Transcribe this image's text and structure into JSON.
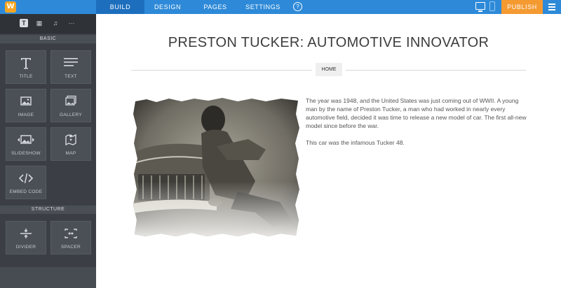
{
  "topbar": {
    "logo": "W",
    "nav": [
      "BUILD",
      "DESIGN",
      "PAGES",
      "SETTINGS"
    ],
    "help": "?",
    "publish": "PUBLISH"
  },
  "sidebar": {
    "tabs": [
      "T",
      "▦",
      "♫",
      "···"
    ],
    "basic_label": "BASIC",
    "structure_label": "STRUCTURE",
    "basic_items": [
      {
        "label": "TITLE",
        "icon": "title-icon"
      },
      {
        "label": "TEXT",
        "icon": "text-icon"
      },
      {
        "label": "IMAGE",
        "icon": "image-icon"
      },
      {
        "label": "GALLERY",
        "icon": "gallery-icon"
      },
      {
        "label": "SLIDESHOW",
        "icon": "slideshow-icon"
      },
      {
        "label": "MAP",
        "icon": "map-icon"
      },
      {
        "label": "EMBED CODE",
        "icon": "embed-code-icon"
      }
    ],
    "structure_items": [
      {
        "label": "DIVIDER",
        "icon": "divider-icon"
      },
      {
        "label": "SPACER",
        "icon": "spacer-icon"
      }
    ]
  },
  "content": {
    "title": "PRESTON TUCKER: AUTOMOTIVE INNOVATOR",
    "home_button": "HOME",
    "paragraph1": "The year was 1948, and the United States was just coming out of WWII. A young man by the name of Preston Tucker, a man who had worked in nearly every automotive field, decided it was time to release a new model of car. The first all-new model since before the war.",
    "paragraph2": "This car was the infamous Tucker 48."
  },
  "colors": {
    "topbar": "#2e8ad8",
    "topbar_active": "#1d6fbe",
    "publish": "#f49a31",
    "sidebar": "#3b3f45"
  }
}
